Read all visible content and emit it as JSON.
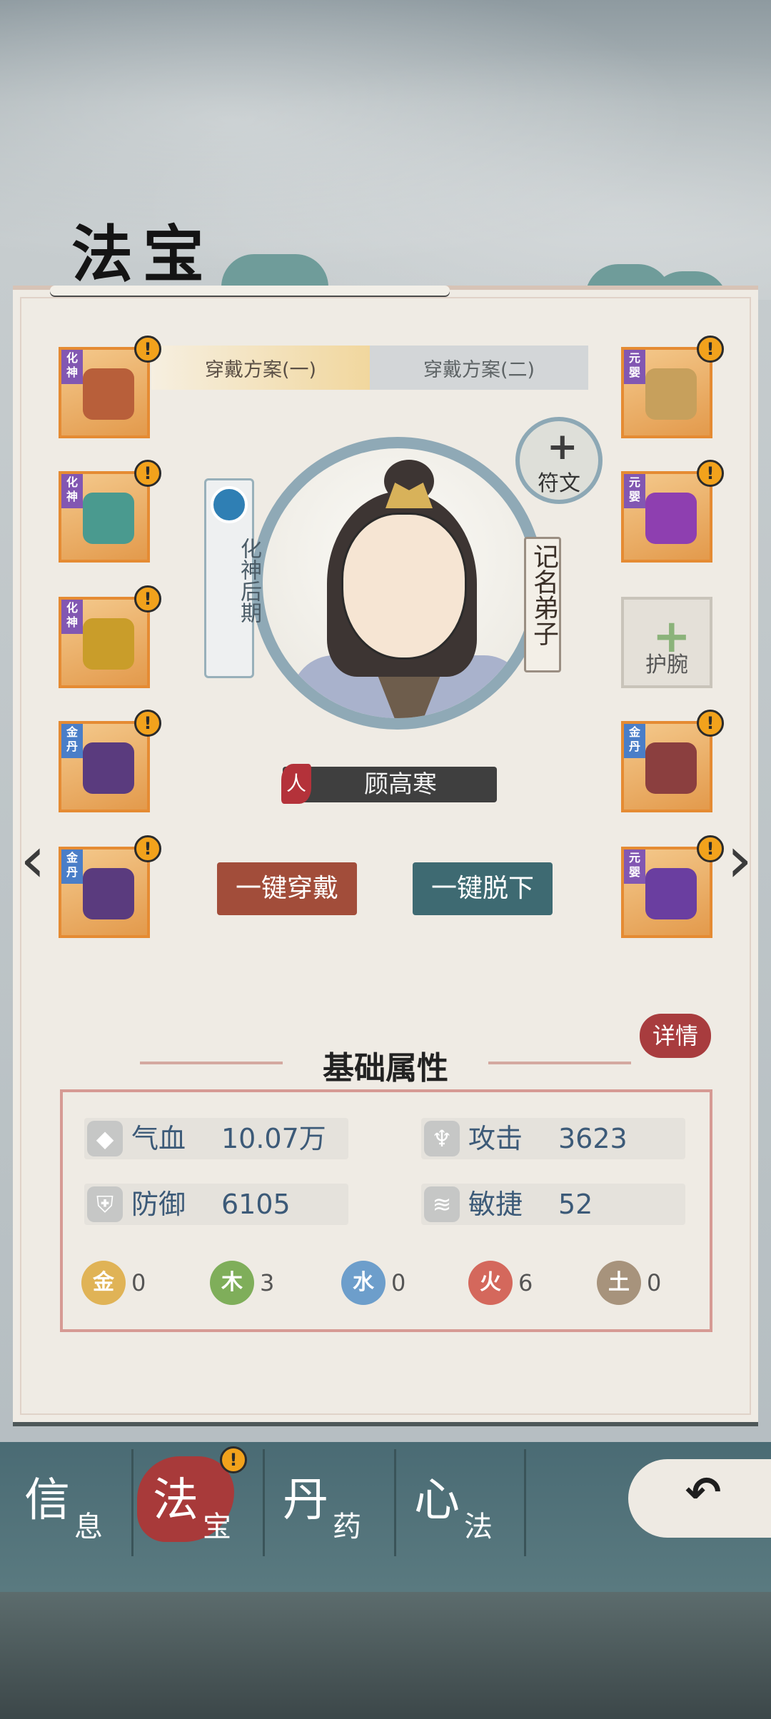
{
  "header": {
    "title": "法宝"
  },
  "tabs": [
    {
      "label": "穿戴方案(一)",
      "active": true
    },
    {
      "label": "穿戴方案(二)",
      "active": false
    }
  ],
  "left_slots": [
    {
      "tag": "化神",
      "color": "#b85f3a",
      "alert": "!"
    },
    {
      "tag": "化神",
      "color": "#4a9a8f",
      "alert": "!"
    },
    {
      "tag": "化神",
      "color": "#c99d2a",
      "alert": "!"
    },
    {
      "tag": "金丹",
      "color": "#5a3b7e",
      "alert": "!"
    },
    {
      "tag": "金丹",
      "color": "#5a3b7e",
      "alert": "!"
    }
  ],
  "right_slots": [
    {
      "tag": "元婴",
      "color": "#c7a05c",
      "alert": "!"
    },
    {
      "tag": "元婴",
      "color": "#8e3fb0",
      "alert": "!"
    },
    {
      "empty": true,
      "label": "护腕"
    },
    {
      "tag": "金丹",
      "color": "#8b3f3f",
      "alert": "!"
    },
    {
      "tag": "元婴",
      "color": "#6a3ea0",
      "alert": "!"
    }
  ],
  "character": {
    "realm": "化神后期",
    "rank": "记名弟子",
    "seal": "人",
    "name": "顾高寒",
    "rune_label": "符文"
  },
  "buttons": {
    "equip_all": "一键穿戴",
    "unequip_all": "一键脱下"
  },
  "attributes": {
    "section_title": "基础属性",
    "detail_label": "详情",
    "stats": [
      {
        "label": "气血",
        "value": "10.07万",
        "icon": "blood-icon"
      },
      {
        "label": "攻击",
        "value": "3623",
        "icon": "attack-icon"
      },
      {
        "label": "防御",
        "value": "6105",
        "icon": "shield-icon"
      },
      {
        "label": "敏捷",
        "value": "52",
        "icon": "wind-icon"
      }
    ],
    "elements": [
      {
        "glyph": "金",
        "count": "0",
        "color": "#e0b356"
      },
      {
        "glyph": "木",
        "count": "3",
        "color": "#7fae5a"
      },
      {
        "glyph": "水",
        "count": "0",
        "color": "#6d9ecb"
      },
      {
        "glyph": "火",
        "count": "6",
        "color": "#d4685c"
      },
      {
        "glyph": "土",
        "count": "0",
        "color": "#a7937c"
      }
    ]
  },
  "nav": [
    {
      "big": "信",
      "small": "息"
    },
    {
      "big": "法",
      "small": "宝",
      "active": true,
      "alert": "!"
    },
    {
      "big": "丹",
      "small": "药"
    },
    {
      "big": "心",
      "small": "法"
    }
  ],
  "arrows": {
    "left": "‹",
    "right": "›"
  },
  "back_icon": "back-arrow-icon"
}
